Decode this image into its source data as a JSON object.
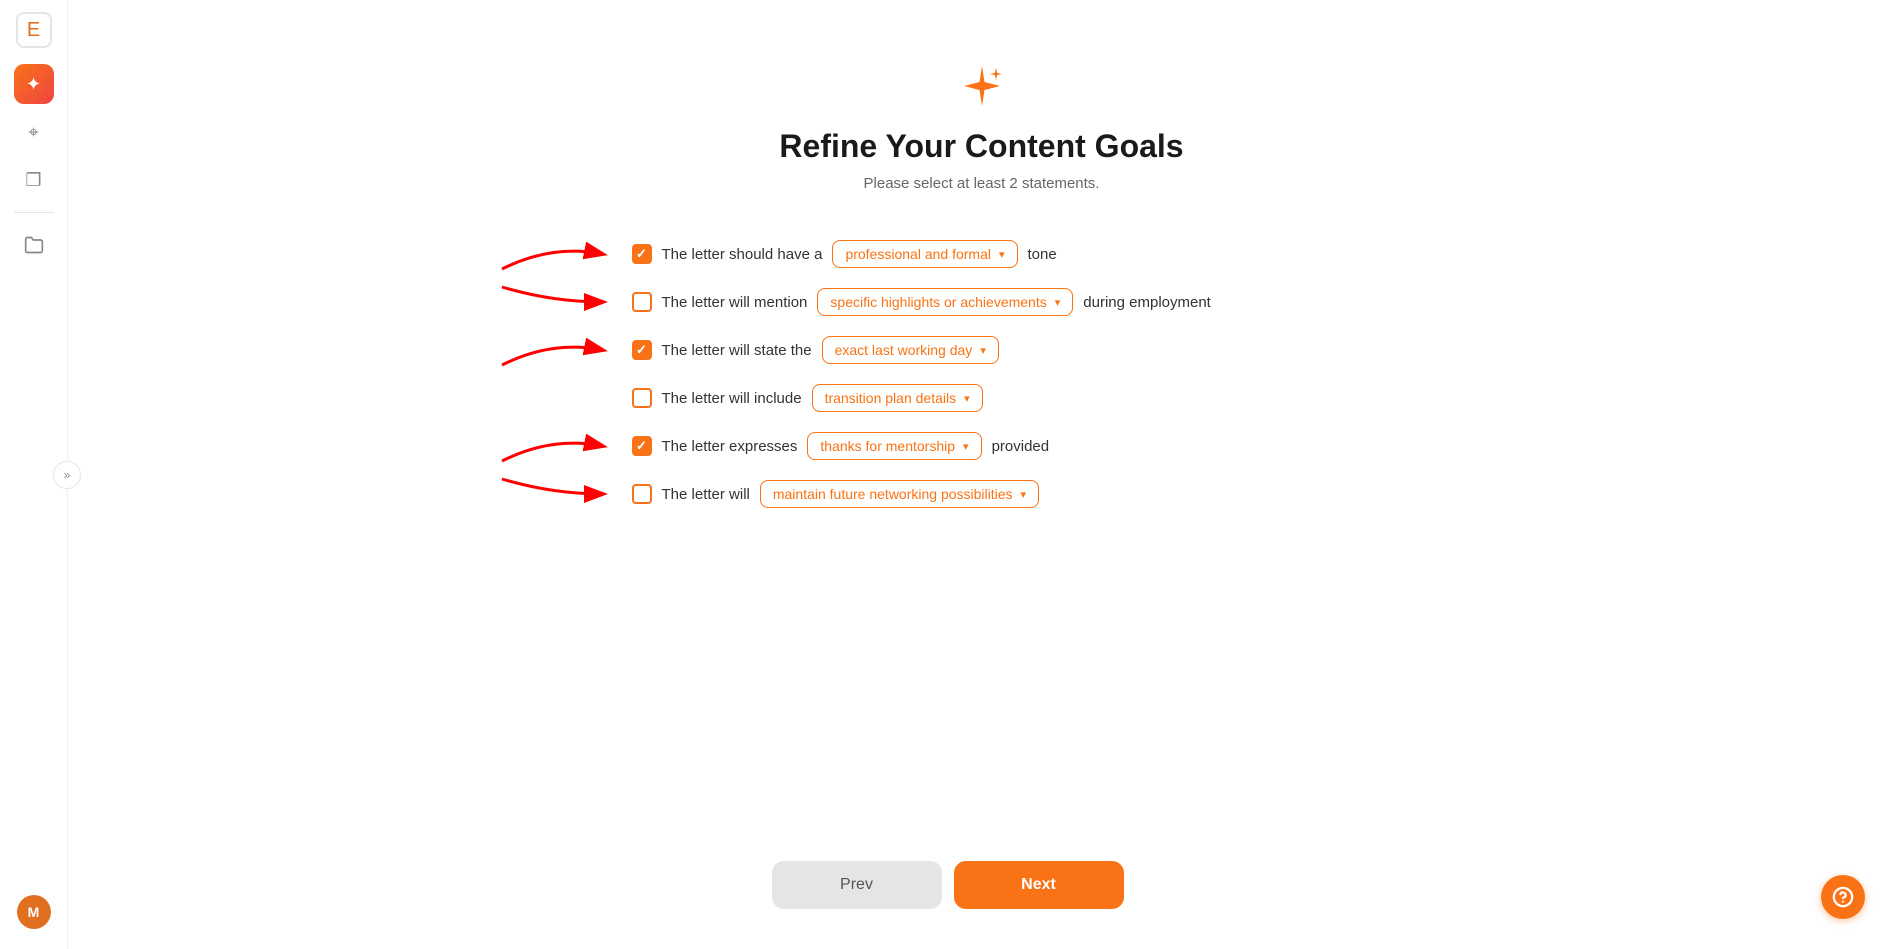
{
  "sidebar": {
    "logo_icon": "E",
    "items": [
      {
        "id": "ai",
        "icon": "✦",
        "active": true,
        "label": "AI Tools"
      },
      {
        "id": "search",
        "icon": "⌖",
        "active": false,
        "label": "Search"
      },
      {
        "id": "clipboard",
        "icon": "❐",
        "active": false,
        "label": "Documents"
      }
    ],
    "folder_icon": "🗂",
    "collapse_icon": "»",
    "avatar_initial": "M"
  },
  "page": {
    "title": "Refine Your Content Goals",
    "subtitle": "Please select at least 2 statements.",
    "statements": [
      {
        "id": "tone",
        "checked": true,
        "text_before": "The letter should have a",
        "dropdown_value": "professional and formal",
        "text_after": "tone",
        "has_arrow": true
      },
      {
        "id": "highlights",
        "checked": false,
        "text_before": "The letter will mention",
        "dropdown_value": "specific highlights or achievements",
        "text_after": "during employment",
        "has_arrow": true
      },
      {
        "id": "lastday",
        "checked": true,
        "text_before": "The letter will state the",
        "dropdown_value": "exact last working day",
        "text_after": "",
        "has_arrow": true
      },
      {
        "id": "transition",
        "checked": false,
        "text_before": "The letter will include",
        "dropdown_value": "transition plan details",
        "text_after": "",
        "has_arrow": false
      },
      {
        "id": "mentorship",
        "checked": true,
        "text_before": "The letter expresses",
        "dropdown_value": "thanks for mentorship",
        "text_after": "provided",
        "has_arrow": true
      },
      {
        "id": "networking",
        "checked": false,
        "text_before": "The letter will",
        "dropdown_value": "maintain future networking possibilities",
        "text_after": "",
        "has_arrow": true
      }
    ]
  },
  "buttons": {
    "prev_label": "Prev",
    "next_label": "Next"
  }
}
